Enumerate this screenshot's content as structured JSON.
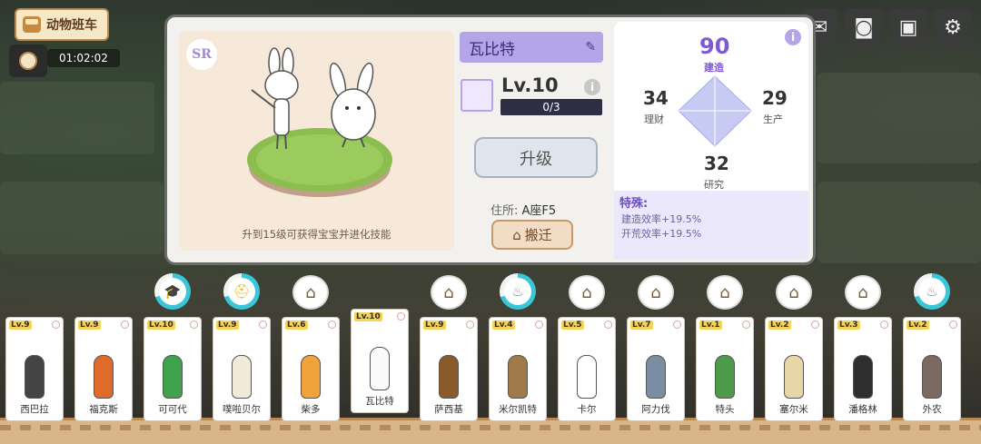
{
  "hud": {
    "bus_label": "动物班车",
    "timer": "01:02:02"
  },
  "top_icons": [
    "mail-icon",
    "camera-icon",
    "save-icon",
    "gear-icon"
  ],
  "detail": {
    "rarity": "SR",
    "evolution_note": "升到15级可获得宝宝并进化技能",
    "name": "瓦比特",
    "level": "Lv.10",
    "exp": "0/3",
    "upgrade_label": "升级",
    "residence_label": "住所:",
    "residence_value": "A座F5",
    "move_label": "搬迁"
  },
  "stats": {
    "build": {
      "value": "90",
      "label": "建造"
    },
    "finance": {
      "value": "34",
      "label": "理财"
    },
    "production": {
      "value": "29",
      "label": "生产"
    },
    "research": {
      "value": "32",
      "label": "研究"
    }
  },
  "special": {
    "title": "特殊:",
    "lines": [
      "建造效率+19.5%",
      "开荒效率+19.5%"
    ]
  },
  "roster": [
    {
      "lv": "Lv.9",
      "name": "西巴拉",
      "status": "none",
      "color": "#444"
    },
    {
      "lv": "Lv.9",
      "name": "福克斯",
      "status": "none",
      "color": "#e06a2a"
    },
    {
      "lv": "Lv.10",
      "name": "可可代",
      "status": "graduate",
      "color": "#3fa34d"
    },
    {
      "lv": "Lv.9",
      "name": "噗啦贝尔",
      "status": "helmet",
      "color": "#f1ead8"
    },
    {
      "lv": "Lv.6",
      "name": "柴多",
      "status": "home",
      "color": "#f0a33b"
    },
    {
      "lv": "Lv.10",
      "name": "瓦比特",
      "status": "none",
      "color": "#fafafa"
    },
    {
      "lv": "Lv.9",
      "name": "萨西基",
      "status": "home",
      "color": "#8a5a2b"
    },
    {
      "lv": "Lv.4",
      "name": "米尔凯特",
      "status": "chef",
      "color": "#a07a4a"
    },
    {
      "lv": "Lv.5",
      "name": "卡尔",
      "status": "home",
      "color": "#fff"
    },
    {
      "lv": "Lv.7",
      "name": "阿力伐",
      "status": "home",
      "color": "#7a8ea3"
    },
    {
      "lv": "Lv.1",
      "name": "特头",
      "status": "home",
      "color": "#4d9a4a"
    },
    {
      "lv": "Lv.2",
      "name": "塞尔米",
      "status": "home",
      "color": "#e7d6a8"
    },
    {
      "lv": "Lv.3",
      "name": "潘格林",
      "status": "home",
      "color": "#2f2f2f"
    },
    {
      "lv": "Lv.2",
      "name": "外农",
      "status": "chef",
      "color": "#7a6a60"
    }
  ]
}
